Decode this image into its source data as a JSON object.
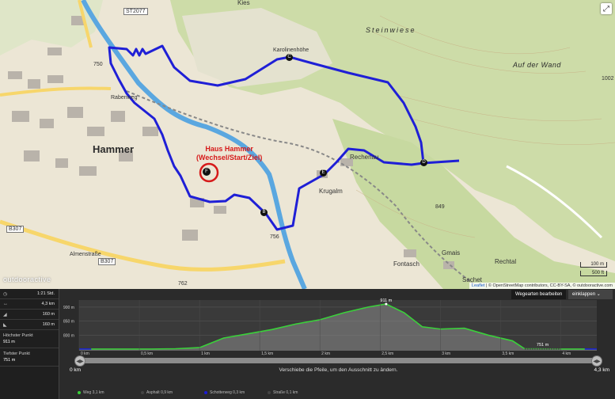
{
  "map": {
    "town_label": "Hammer",
    "area_labels": [
      "Steinwiese",
      "Auf der Wand"
    ],
    "places": [
      "Kies",
      "Karolinenhöhe",
      "Rechenau",
      "Krugalm",
      "Fontasch",
      "Gmais",
      "Rechtal",
      "Sachet"
    ],
    "elevation_marks": [
      "849",
      "756",
      "762",
      "1002",
      "750"
    ],
    "road_labels": [
      "ST2077",
      "B307",
      "B307",
      "Rabenweg",
      "Almenstraße"
    ],
    "start_label_line1": "Haus Hammer",
    "start_label_line2": "(Wechsel/Start/Ziel)",
    "waypoints": [
      "F",
      "C",
      "D",
      "E",
      "B"
    ],
    "logo": "outdooractive",
    "scale_m": "100 m",
    "scale_ft": "500 ft",
    "attribution_prefix": "Leaflet",
    "attribution_text": "| © OpenStreetMap contributors, CC-BY-SA, © outdooractive.com",
    "expand_icon": "expand-icon",
    "route_color": "#1f1fd6",
    "river_color": "#5aa7e0",
    "start_marker_color": "#d61a1a"
  },
  "stats": {
    "duration": "1:21 Std.",
    "distance": "4,3 km",
    "ascent": "160 m",
    "descent": "160 m",
    "highest_label": "Höchster Punkt",
    "highest_value": "911 m",
    "lowest_label": "Tiefster Punkt",
    "lowest_value": "751 m"
  },
  "profile": {
    "edit_button": "Wegearten bearbeiten",
    "collapse_button": "einklappen",
    "y_labels": [
      "900 m",
      "850 m",
      "800 m"
    ],
    "x_labels": [
      "0 km",
      "0,5 km",
      "1 km",
      "1,5 km",
      "2 km",
      "2,5 km",
      "3 km",
      "3,5 km",
      "4 km"
    ],
    "peak_label": "911 m",
    "low_label": "751 m",
    "slider_start": "0 km",
    "slider_end": "4,3 km",
    "slider_hint": "Verschiebe die Pfeile, um den Ausschnitt zu ändern.",
    "legend": [
      {
        "label": "Weg 3,1 km",
        "color": "#3ad13a"
      },
      {
        "label": "Asphalt 0,9 km",
        "color": "#444444"
      },
      {
        "label": "Schotterweg 0,3 km",
        "color": "#1a1ad6"
      },
      {
        "label": "Straße 0,1 km",
        "color": "#444444"
      }
    ]
  },
  "chart_data": {
    "type": "area",
    "x": [
      0,
      0.1,
      0.3,
      0.5,
      0.6,
      0.8,
      1.0,
      1.2,
      1.4,
      1.6,
      1.8,
      2.0,
      2.2,
      2.4,
      2.55,
      2.7,
      2.85,
      3.0,
      3.2,
      3.4,
      3.6,
      3.7,
      4.0,
      4.2,
      4.3
    ],
    "y": [
      751,
      751,
      751,
      751,
      751,
      752,
      756,
      790,
      805,
      820,
      840,
      855,
      880,
      900,
      911,
      880,
      830,
      822,
      825,
      800,
      780,
      752,
      751,
      751,
      751
    ],
    "xlabel": "",
    "ylabel": "",
    "xlim": [
      0,
      4.3
    ],
    "ylim": [
      745,
      925
    ],
    "y_ticks": [
      800,
      850,
      900
    ],
    "x_ticks": [
      0,
      0.5,
      1,
      1.5,
      2,
      2.5,
      3,
      3.5,
      4
    ],
    "grid": true
  }
}
